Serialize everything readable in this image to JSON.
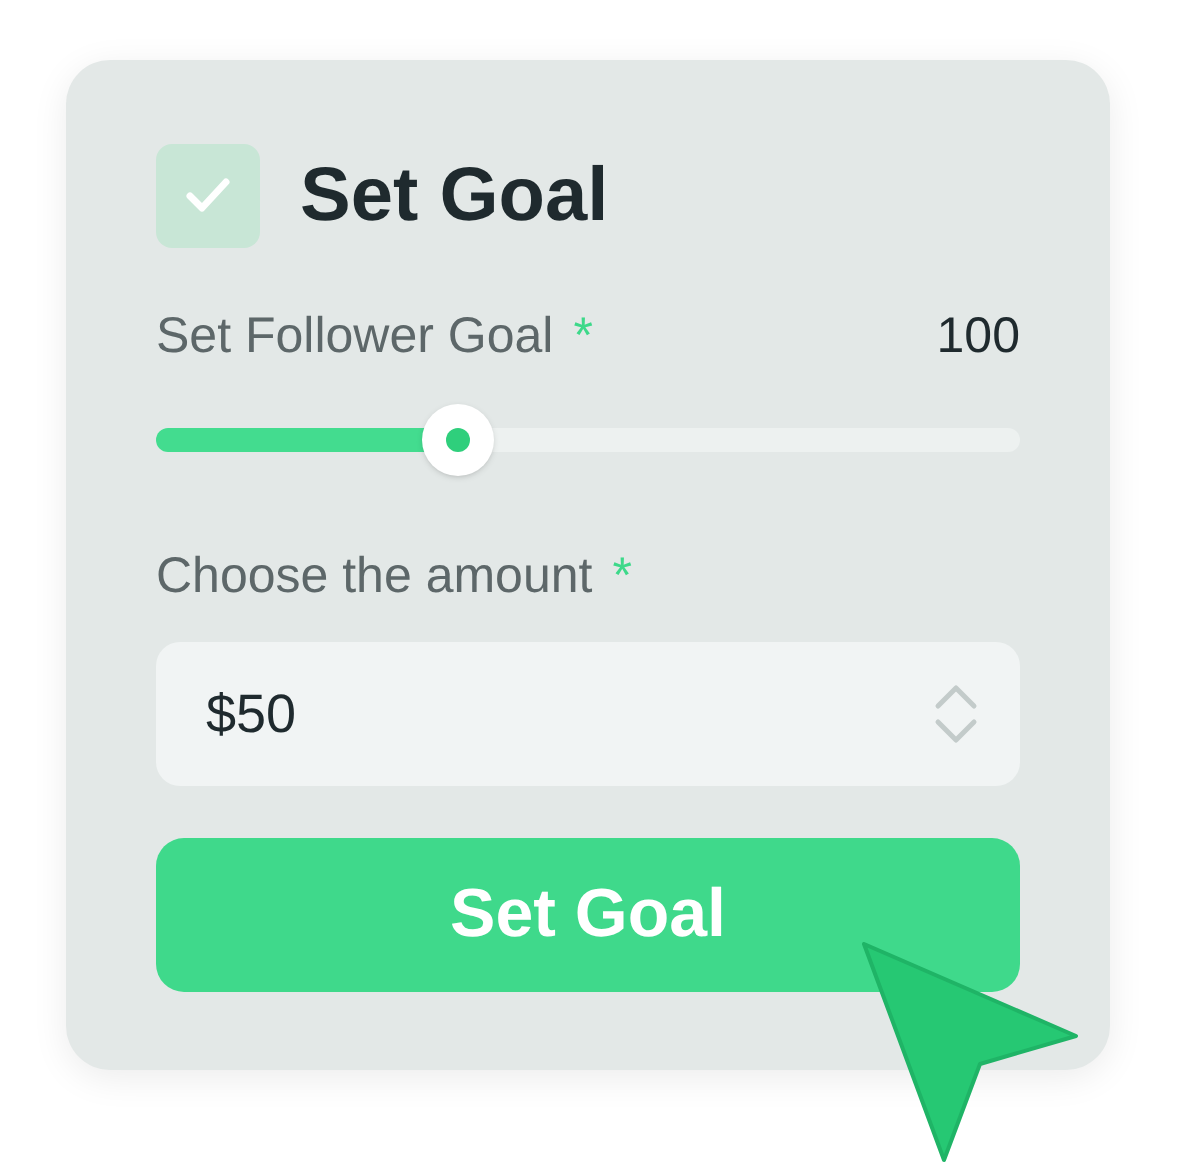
{
  "header": {
    "checked": true,
    "title": "Set Goal"
  },
  "slider": {
    "label": "Set Follower Goal",
    "required_mark": "*",
    "value": "100",
    "level": 0.35
  },
  "amount": {
    "label": "Choose the amount",
    "required_mark": "*",
    "value": "$50"
  },
  "button": {
    "label": "Set Goal"
  }
}
